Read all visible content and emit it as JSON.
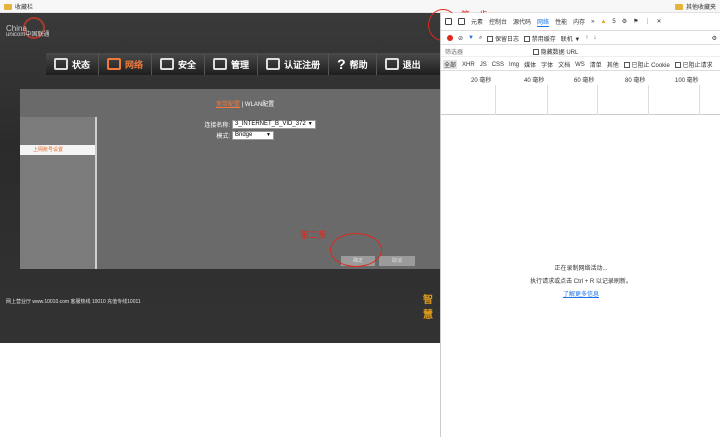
{
  "bookmarks": {
    "left": "收藏栏",
    "right": "其他收藏夹"
  },
  "router": {
    "logo_line1": "China",
    "logo_line2": "unicom中国联通",
    "nav": [
      "状态",
      "网络",
      "安全",
      "管理",
      "认证注册",
      "帮助",
      "退出"
    ],
    "active_nav": "网络",
    "tabs": {
      "active": "宽带配置",
      "other": "WLAN配置"
    },
    "sidebar_item": "上网账号设置",
    "form": {
      "conn_label": "连接名称:",
      "conn_value": "3_INTERNET_B_VID_372",
      "mode_label": "模式:",
      "mode_value": "Bridge"
    },
    "btn_save": "确定",
    "btn_cancel": "取消",
    "footer": "网上营业厅 www.10010.com    客服热线 10010  充值专线10011",
    "brand_mark": "智慧"
  },
  "annotations": {
    "step1": "第一步",
    "step2": "第二步"
  },
  "devtools": {
    "tabs": [
      "元素",
      "控制台",
      "源代码",
      "网络",
      "性能",
      "内存"
    ],
    "active_tab": "网络",
    "more": "»",
    "warn_count": "5",
    "toolbar": {
      "preserve_log": "保留日志",
      "disable_cache": "禁用缓存",
      "throttle": "联机"
    },
    "filter_placeholder": "筛选器",
    "hide_data_url": "隐藏数据 URL",
    "types": [
      "全部",
      "XHR",
      "JS",
      "CSS",
      "Img",
      "媒体",
      "字体",
      "文档",
      "WS",
      "清单",
      "其他"
    ],
    "blocked_cookies": "已阻止 Cookie",
    "blocked_requests": "已阻止请求",
    "ticks": [
      "20 毫秒",
      "40 毫秒",
      "60 毫秒",
      "80 毫秒",
      "100 毫秒"
    ],
    "recording": "正在录制网络活动...",
    "hint": "执行请求或点击 Ctrl + R 以记录刷新。",
    "learn_more": "了解更多信息"
  }
}
